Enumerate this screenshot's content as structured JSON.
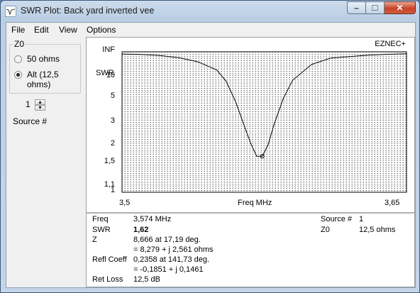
{
  "window": {
    "title": "SWR Plot: Back yard inverted vee",
    "min_glyph": "–",
    "max_glyph": "□",
    "close_glyph": "✕"
  },
  "menu": [
    "File",
    "Edit",
    "View",
    "Options"
  ],
  "z0_group": {
    "label": "Z0",
    "options": [
      {
        "label": "50 ohms",
        "checked": false
      },
      {
        "label_line1": "Alt (12,5",
        "label_line2": "ohms)",
        "checked": true
      }
    ]
  },
  "source_spinner": {
    "value": "1",
    "label": "Source #",
    "up_glyph": "▴",
    "down_glyph": "▾"
  },
  "plot": {
    "brand": "EZNEC+",
    "y_axis_title": "SWR",
    "y_ticks": [
      "INF",
      "10",
      "5",
      "3",
      "2",
      "1,5",
      "1,1",
      "1"
    ],
    "x_start": "3,5",
    "x_end": "3,65",
    "x_title": "Freq MHz"
  },
  "chart_data": {
    "type": "line",
    "xlabel": "Freq MHz",
    "ylabel": "SWR",
    "xlim": [
      3.5,
      3.65
    ],
    "y_scale": "swr (reflection-coefficient)",
    "ylim": [
      1,
      "INF"
    ],
    "grid": true,
    "series": [
      {
        "x": [
          3.5,
          3.51,
          3.52,
          3.53,
          3.54,
          3.55,
          3.555,
          3.56,
          3.565,
          3.568,
          3.571,
          3.574,
          3.577,
          3.58,
          3.585,
          3.59,
          3.6,
          3.61,
          3.62,
          3.63,
          3.64,
          3.65
        ],
        "y": [
          20.9,
          20.1,
          18.7,
          16.2,
          13,
          9.17,
          6.35,
          3.9,
          2.43,
          1.93,
          1.62,
          1.62,
          1.9,
          2.57,
          4.2,
          6.6,
          11.5,
          15.9,
          17.5,
          19.2,
          20.4,
          21.4
        ]
      }
    ]
  },
  "readout": {
    "freq_label": "Freq",
    "freq_value": "3,574 MHz",
    "swr_label": "SWR",
    "swr_value": "1,62",
    "z_label": "Z",
    "z_polar": "8,666 at 17,19 deg.",
    "z_rect": "= 8,279 + j 2,561 ohms",
    "refl_label": "Refl Coeff",
    "refl_polar": "0,2358 at 141,73 deg.",
    "refl_rect": "= -0,1851 + j 0,1461",
    "retloss_label": "Ret Loss",
    "retloss_value": "12,5 dB",
    "source_label": "Source #",
    "source_value": "1",
    "z0_label": "Z0",
    "z0_value": "12,5 ohms"
  }
}
